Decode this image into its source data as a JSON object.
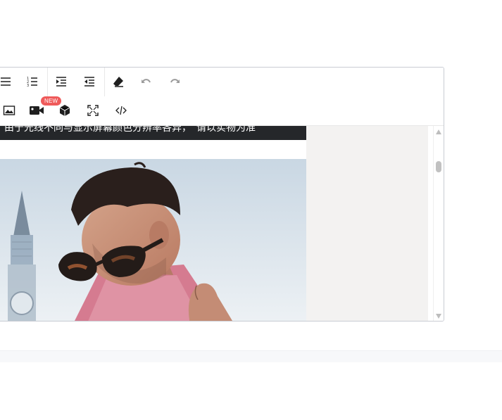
{
  "toolbar": {
    "row1": [
      {
        "name": "align-justify-icon",
        "label": "Align"
      },
      {
        "name": "ordered-list-icon",
        "label": "Ordered list"
      },
      {
        "name": "indent-icon",
        "label": "Indent"
      },
      {
        "name": "outdent-icon",
        "label": "Outdent"
      },
      {
        "name": "eraser-icon",
        "label": "Clear formatting"
      },
      {
        "name": "undo-icon",
        "label": "Undo"
      },
      {
        "name": "redo-icon",
        "label": "Redo"
      }
    ],
    "row2": [
      {
        "name": "image-icon",
        "label": "Insert image"
      },
      {
        "name": "video-icon",
        "label": "Insert video"
      },
      {
        "name": "3d-box-icon",
        "label": "Insert 3D model"
      },
      {
        "name": "fullscreen-icon",
        "label": "Fullscreen"
      },
      {
        "name": "code-icon",
        "label": "Source code"
      }
    ],
    "new_badge": "NEW"
  },
  "content": {
    "banner_text": "由于光线不同与显示屏幕颜色分辨率各异，　请以实物为准"
  },
  "colors": {
    "border": "#c9ccd3",
    "badge": "#ef5a5a",
    "banner": "#25272a",
    "canvas": "#f3f2f1"
  }
}
